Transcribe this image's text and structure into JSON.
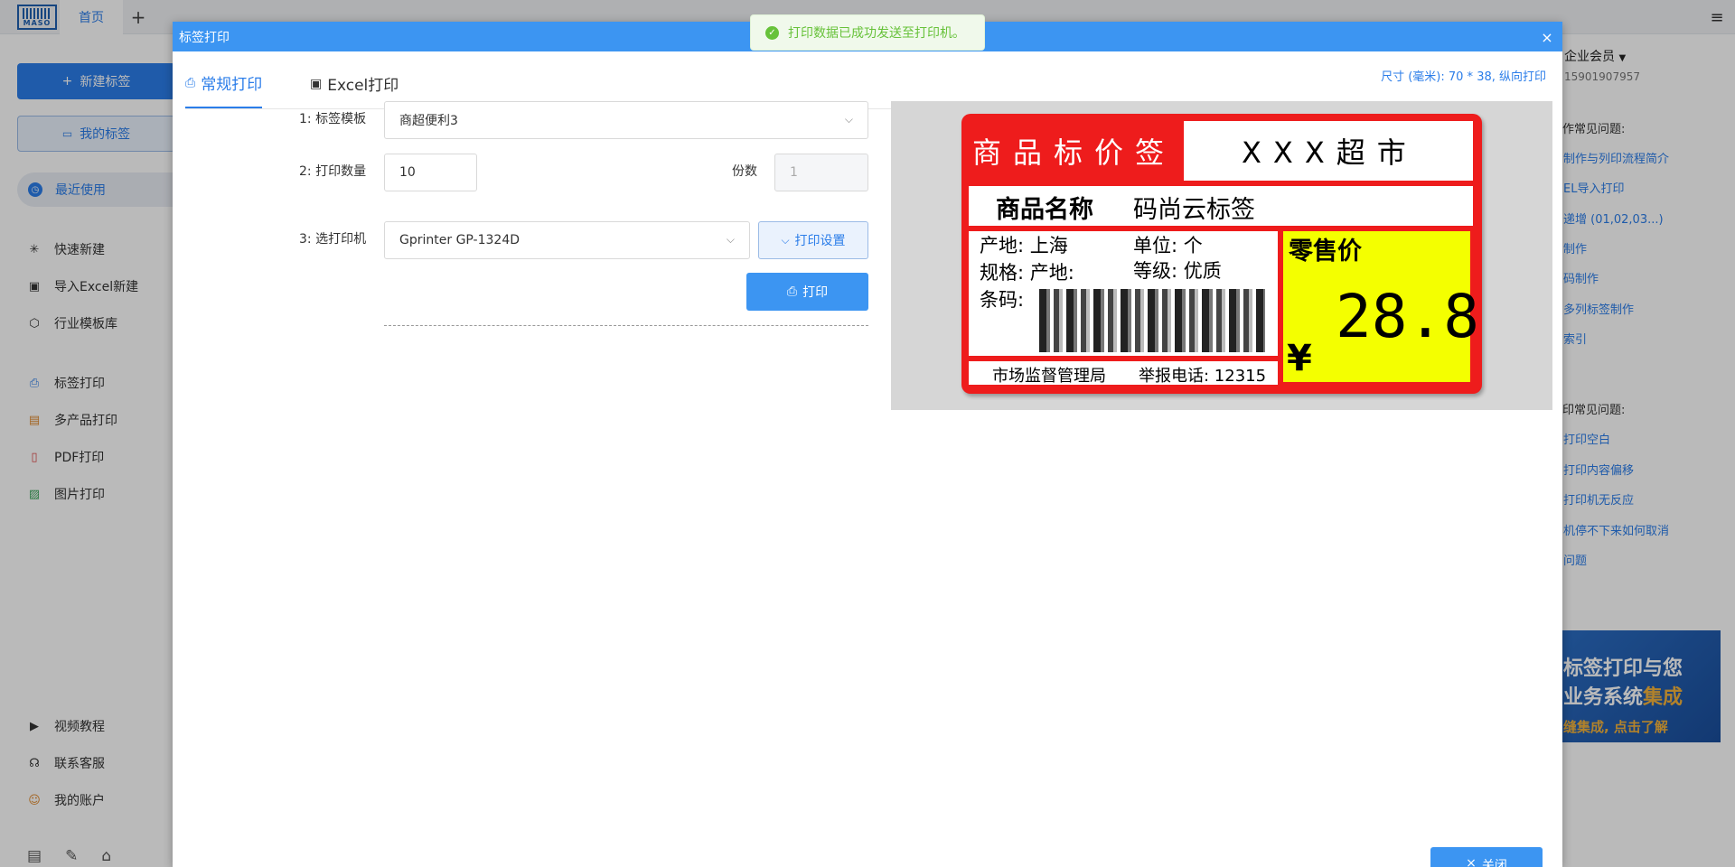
{
  "app": {
    "logo_text": "MASO",
    "home_tab": "首页",
    "add_tab": "+",
    "menu_icon": "≡"
  },
  "sidebar": {
    "new_label": "新建标签",
    "my_labels": "我的标签",
    "recent": "最近使用",
    "items": [
      {
        "label": "快速新建",
        "icon": "sparkle-icon"
      },
      {
        "label": "导入Excel新建",
        "icon": "excel-icon"
      },
      {
        "label": "行业模板库",
        "icon": "cube-icon"
      },
      {
        "label": "标签打印",
        "icon": "printer-icon"
      },
      {
        "label": "多产品打印",
        "icon": "multi-print-icon"
      },
      {
        "label": "PDF打印",
        "icon": "pdf-icon"
      },
      {
        "label": "图片打印",
        "icon": "image-icon"
      }
    ],
    "bottom_items": [
      {
        "label": "视频教程",
        "icon": "video-icon"
      },
      {
        "label": "联系客服",
        "icon": "headset-icon"
      },
      {
        "label": "我的账户",
        "icon": "user-icon"
      }
    ]
  },
  "right_panel": {
    "member": "企业会员",
    "phone": "15901907957",
    "section1_title": "作常见问题:",
    "section1_links": [
      "制作与列印流程简介",
      "EL导入打印",
      "递增 (01,02,03...)",
      "制作",
      "码制作",
      "多列标签制作",
      "索引"
    ],
    "section2_title": "印常见问题:",
    "section2_links": [
      "打印空白",
      "打印内容偏移",
      "打印机无反应",
      "机停不下来如何取消",
      "问题"
    ],
    "banner_line1": "标签打印与您",
    "banner_line2a": "业务系统",
    "banner_line2b": "集成",
    "banner_line3": "缝集成, 点击了解"
  },
  "dialog": {
    "title": "标签打印",
    "close": "×",
    "tabs": [
      {
        "label": "常规打印",
        "active": true
      },
      {
        "label": "Excel打印",
        "active": false
      }
    ],
    "size_info": "尺寸 (毫米): 70 * 38, 纵向打印",
    "template_label": "1: 标签模板",
    "template_value": "商超便利3",
    "quantity_label": "2: 打印数量",
    "quantity_value": "10",
    "copies_label": "份数",
    "copies_value": "1",
    "printer_label": "3: 选打印机",
    "printer_value": "Gprinter GP-1324D",
    "settings_button": "打印设置",
    "print_button": "打印",
    "close_button": "关闭"
  },
  "label_preview": {
    "header": "商品标价签",
    "store": "XXX超市",
    "name_label": "商品名称",
    "name_value": "码尚云标签",
    "origin": "产地: 上海",
    "unit": "单位: 个",
    "spec": "规格: 产地:",
    "grade": "等级: 优质",
    "barcode": "条码:",
    "price_label": "零售价",
    "price": "28.8",
    "currency": "¥",
    "footer_left": "市场监督管理局",
    "footer_right": "举报电话: 12315"
  },
  "toast": {
    "message": "打印数据已成功发送至打印机。"
  },
  "colors": {
    "primary": "#3c95f2",
    "label_red": "#ee1c1c",
    "price_yellow": "#f4ff00",
    "success": "#67c23a"
  }
}
